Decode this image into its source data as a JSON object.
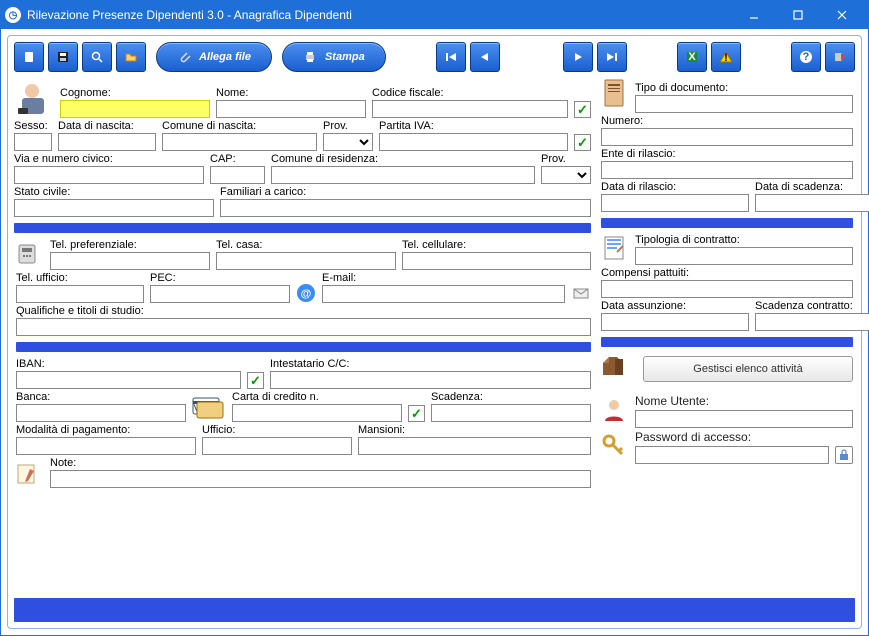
{
  "window": {
    "title": "Rilevazione Presenze Dipendenti 3.0 - Anagrafica Dipendenti"
  },
  "toolbar": {
    "attach": "Allega file",
    "print": "Stampa"
  },
  "s1": {
    "cognome": "Cognome:",
    "nome": "Nome:",
    "cf": "Codice fiscale:",
    "sesso": "Sesso:",
    "data_nascita": "Data di nascita:",
    "comune_nascita": "Comune di nascita:",
    "prov1": "Prov.",
    "piva": "Partita IVA:",
    "via": "Via e numero civico:",
    "cap": "CAP:",
    "comune_res": "Comune di residenza:",
    "prov2": "Prov.",
    "stato_civile": "Stato civile:",
    "familiari": "Familiari a carico:"
  },
  "s2": {
    "tel_pref": "Tel. preferenziale:",
    "tel_casa": "Tel. casa:",
    "tel_cell": "Tel. cellulare:",
    "tel_uff": "Tel. ufficio:",
    "pec": "PEC:",
    "email": "E-mail:",
    "qualifiche": "Qualifiche e titoli di studio:"
  },
  "s3": {
    "iban": "IBAN:",
    "intestatario": "Intestatario C/C:",
    "banca": "Banca:",
    "cc_num": "Carta di credito n.",
    "scadenza": "Scadenza:",
    "modalita": "Modalità di pagamento:",
    "ufficio": "Ufficio:",
    "mansioni": "Mansioni:",
    "note": "Note:"
  },
  "r1": {
    "tipo_doc": "Tipo di documento:",
    "numero": "Numero:",
    "ente": "Ente di rilascio:",
    "data_ril": "Data di rilascio:",
    "data_scad": "Data di scadenza:"
  },
  "r2": {
    "tipologia": "Tipologia di contratto:",
    "compensi": "Compensi pattuiti:",
    "assunzione": "Data assunzione:",
    "scad_contratto": "Scadenza contratto:"
  },
  "r3": {
    "gestisci": "Gestisci elenco attività",
    "utente": "Nome Utente:",
    "password": "Password di accesso:"
  }
}
